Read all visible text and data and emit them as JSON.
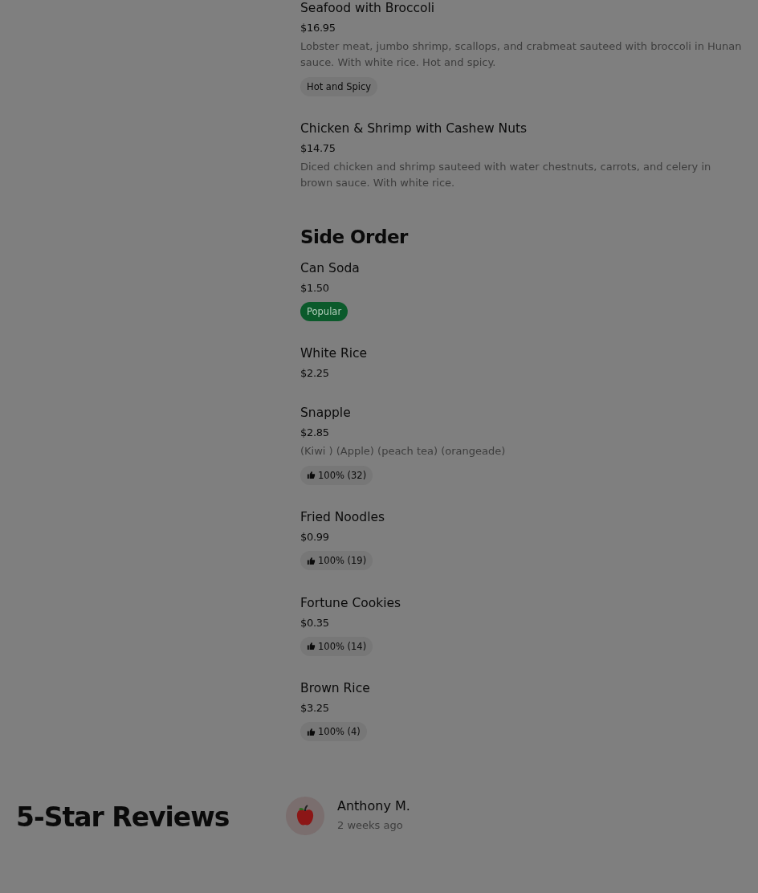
{
  "menu_sections": [
    {
      "items": [
        {
          "name": "Seafood with Broccoli",
          "price": "$16.95",
          "description": "Lobster meat, jumbo shrimp, scallops, and crabmeat sauteed with broccoli in Hunan sauce. With white rice. Hot and spicy.",
          "badges": [
            {
              "kind": "tag",
              "text": "Hot and Spicy"
            }
          ]
        },
        {
          "name": "Chicken & Shrimp with Cashew Nuts",
          "price": "$14.75",
          "description": "Diced chicken and shrimp sauteed with water chestnuts, carrots, and celery in brown sauce. With white rice."
        }
      ]
    },
    {
      "title": "Side Order",
      "items": [
        {
          "name": "Can Soda",
          "price": "$1.50",
          "badges": [
            {
              "kind": "popular",
              "text": "Popular"
            }
          ]
        },
        {
          "name": "White Rice",
          "price": "$2.25"
        },
        {
          "name": "Snapple",
          "price": "$2.85",
          "description": "(Kiwi ) (Apple) (peach tea) (orangeade)",
          "badges": [
            {
              "kind": "rating",
              "text": "100% (32)"
            }
          ]
        },
        {
          "name": "Fried Noodles",
          "price": "$0.99",
          "badges": [
            {
              "kind": "rating",
              "text": "100% (19)"
            }
          ]
        },
        {
          "name": "Fortune Cookies",
          "price": "$0.35",
          "badges": [
            {
              "kind": "rating",
              "text": "100% (14)"
            }
          ]
        },
        {
          "name": "Brown Rice",
          "price": "$3.25",
          "badges": [
            {
              "kind": "rating",
              "text": "100% (4)"
            }
          ]
        }
      ]
    }
  ],
  "reviews": {
    "title": "5-Star Reviews",
    "items": [
      {
        "author": "Anthony M.",
        "time": "2 weeks ago"
      }
    ]
  }
}
